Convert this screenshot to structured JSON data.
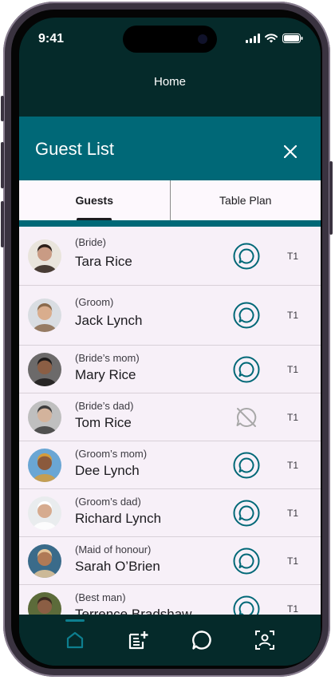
{
  "status_bar": {
    "time": "9:41"
  },
  "top_bar": {
    "title": "Home"
  },
  "sheet": {
    "title": "Guest List",
    "tabs": [
      {
        "label": "Guests",
        "active": true
      },
      {
        "label": "Table Plan",
        "active": false
      }
    ]
  },
  "guests": [
    {
      "role": "(Bride)",
      "name": "Tara Rice",
      "table": "T1",
      "chat": "available",
      "avatar_colors": [
        "#e9e4dc",
        "#2b1e18",
        "#c99b84"
      ]
    },
    {
      "role": "(Groom)",
      "name": "Jack Lynch",
      "table": "T1",
      "chat": "available",
      "avatar_colors": [
        "#d9dde2",
        "#8a6a4c",
        "#d9ad8d"
      ]
    },
    {
      "role": "(Bride’s mom)",
      "name": "Mary Rice",
      "table": "T1",
      "chat": "available",
      "avatar_colors": [
        "#6c6a6a",
        "#1c1a1a",
        "#8b5e44"
      ]
    },
    {
      "role": "(Bride’s dad)",
      "name": "Tom Rice",
      "table": "T1",
      "chat": "unavailable",
      "avatar_colors": [
        "#bfbfbf",
        "#3c3c3c",
        "#d3b39c"
      ]
    },
    {
      "role": "(Groom’s mom)",
      "name": "Dee Lynch",
      "table": "T1",
      "chat": "available",
      "avatar_colors": [
        "#6aa6d4",
        "#d49c3c",
        "#8b5a3c"
      ]
    },
    {
      "role": "(Groom’s dad)",
      "name": "Richard Lynch",
      "table": "T1",
      "chat": "available",
      "avatar_colors": [
        "#e9ecee",
        "#ffffff",
        "#d6ab8f"
      ]
    },
    {
      "role": "(Maid of honour)",
      "name": "Sarah O’Brien",
      "table": "T1",
      "chat": "available",
      "avatar_colors": [
        "#3a6b8a",
        "#e6c79a",
        "#b07a56"
      ]
    },
    {
      "role": "(Best man)",
      "name": "Terrence Bradshaw",
      "table": "T1",
      "chat": "available",
      "avatar_colors": [
        "#5c6b3a",
        "#3a2a20",
        "#8b5e44"
      ]
    }
  ],
  "bottom_nav": [
    {
      "icon": "home-icon",
      "active": true
    },
    {
      "icon": "add-note-icon",
      "active": false
    },
    {
      "icon": "chat-icon",
      "active": false
    },
    {
      "icon": "contact-icon",
      "active": false
    }
  ],
  "colors": {
    "primary": "#006877",
    "dark": "#052a2a",
    "chat_enabled": "#006877",
    "chat_disabled": "#a8a8a8"
  }
}
